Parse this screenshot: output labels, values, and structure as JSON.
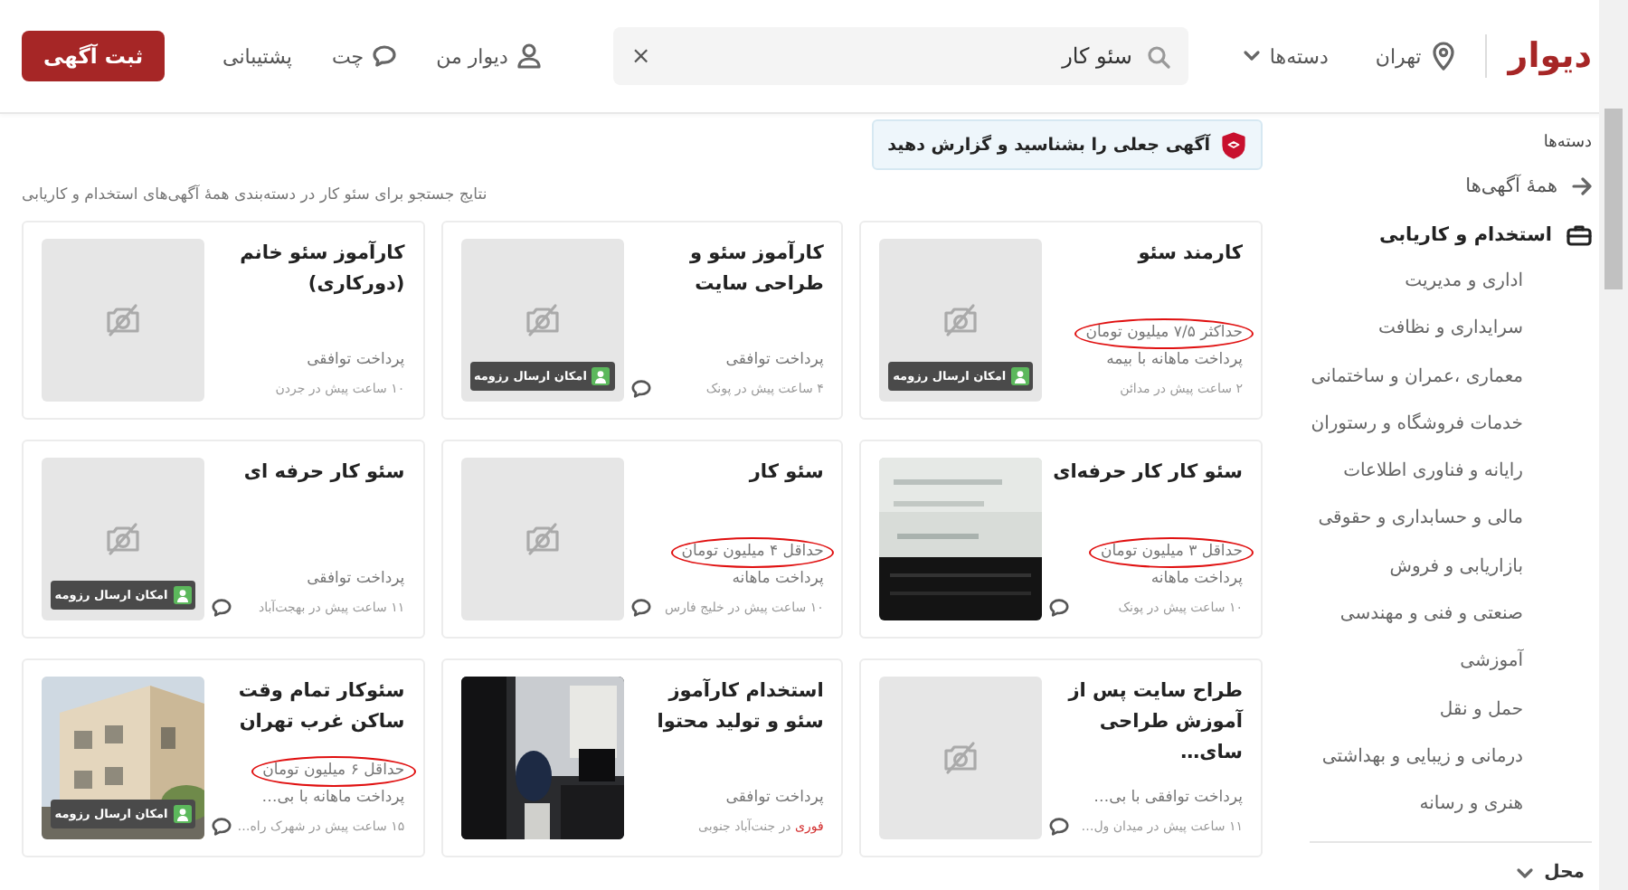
{
  "header": {
    "logo": "دیوار",
    "city": "تهران",
    "categories_label": "دسته‌ها",
    "search": {
      "value": "سئو کار",
      "clear": "×"
    },
    "links": [
      {
        "kind": "user",
        "label": "دیوار من"
      },
      {
        "kind": "chat",
        "label": "چت"
      },
      {
        "kind": "plain",
        "label": "پشتیبانی"
      }
    ],
    "post_button": "ثبت آگهی"
  },
  "sidebar": {
    "heading": "دسته‌ها",
    "all_link": "همهٔ آگهی‌ها",
    "category": "استخدام و کاریابی",
    "items": [
      "اداری و مدیریت",
      "سرایداری و نظافت",
      "معماری ،عمران و ساختمانی",
      "خدمات فروشگاه و رستوران",
      "رایانه و فناوری اطلاعات",
      "مالی و حسابداری و حقوقی",
      "بازاریابی و فروش",
      "صنعتی و فنی و مهندسی",
      "آموزشی",
      "حمل و نقل",
      "درمانی و زیبایی و بهداشتی",
      "هنری و رسانه"
    ],
    "location_label": "محل"
  },
  "notice": "آگهی جعلی را بشناسید و گزارش دهید",
  "results_text": "نتایج جستجو برای سئو کار در دسته‌بندی همهٔ آگهی‌های استخدام و کاریابی",
  "cards": [
    {
      "title": "کارمند سئو",
      "salary": "حداکثر ۷/۵ میلیون تومان",
      "circled": true,
      "payment": "پرداخت ماهانه با بیمه",
      "meta": "۲ ساعت پیش در مدائن",
      "chat": false,
      "resume": "امکان ارسال رزومه",
      "kind": "no-photo"
    },
    {
      "title": "کارآموز سئو و طراحی سایت",
      "payment": "پرداخت توافقی",
      "meta": "۴ ساعت پیش در پونک",
      "chat": true,
      "resume": "امکان ارسال رزومه",
      "kind": "no-photo"
    },
    {
      "title": "کارآموز سئو خانم (دورکاری)",
      "payment": "پرداخت توافقی",
      "meta": "۱۰ ساعت پیش در جردن",
      "chat": false,
      "kind": "no-photo"
    },
    {
      "title": "سئو کار کار حرفه‌ای",
      "salary": "حداقل ۳ میلیون تومان",
      "circled": true,
      "payment": "پرداخت ماهانه",
      "meta": "۱۰ ساعت پیش در پونک",
      "chat": true
    },
    {
      "title": "سئو کار",
      "salary": "حداقل ۴ میلیون تومان",
      "circled": true,
      "payment": "پرداخت ماهانه",
      "meta": "۱۰ ساعت پیش در خلیج فارس",
      "chat": true,
      "kind": "no-photo"
    },
    {
      "title": "سئو کار حرفه ای",
      "payment": "پرداخت توافقی",
      "meta": "۱۱ ساعت پیش در بهجت‌آباد",
      "chat": true,
      "resume": "امکان ارسال رزومه",
      "kind": "no-photo"
    },
    {
      "title": "طراح سایت پس از آموزش طراحی سای…",
      "payment": "پرداخت توافقی با بی…",
      "meta": "۱۱ ساعت پیش در میدان ول…",
      "chat": true,
      "kind": "no-photo"
    },
    {
      "title": "استخدام کارآموز سئو و تولید محتوا",
      "payment": "پرداخت توافقی",
      "urgent": "فوری",
      "meta": "در جنت‌آباد جنوبی",
      "chat": false
    },
    {
      "title": "سئوکار تمام وقت ساکن غرب تهران",
      "salary": "حداقل ۶ میلیون تومان",
      "circled": true,
      "payment": "پرداخت ماهانه با بی…",
      "meta": "۱۵ ساعت پیش در شهرک راه…",
      "chat": true,
      "resume": "امکان ارسال رزومه"
    }
  ]
}
